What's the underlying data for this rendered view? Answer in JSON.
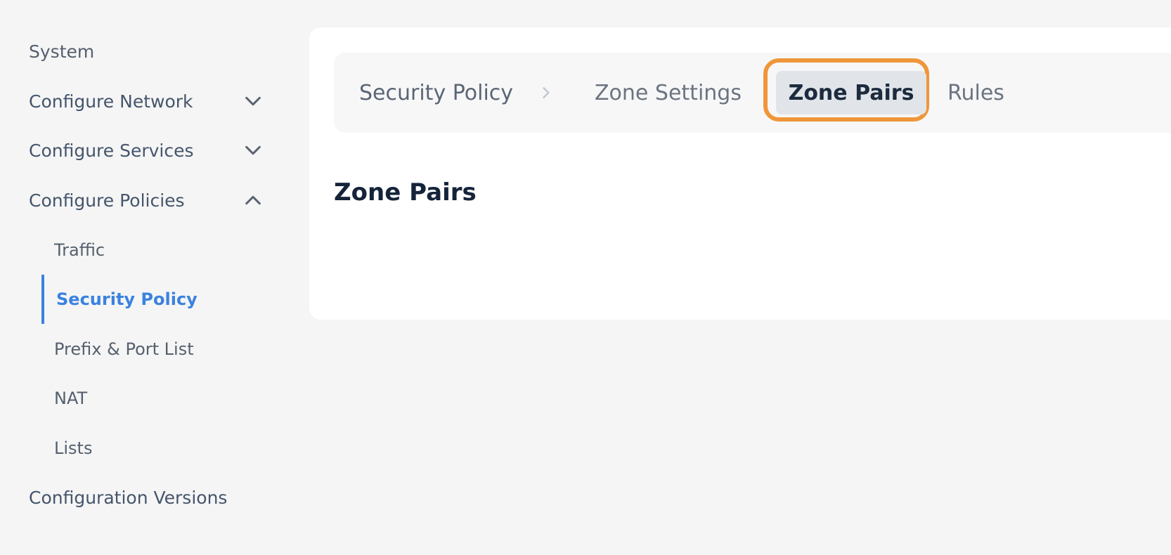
{
  "sidebar": {
    "system": "System",
    "configure_network": "Configure Network",
    "configure_services": "Configure Services",
    "configure_policies": "Configure Policies",
    "policy_items": [
      {
        "label": "Traffic"
      },
      {
        "label": "Security Policy"
      },
      {
        "label": "Prefix & Port List"
      },
      {
        "label": "NAT"
      },
      {
        "label": "Lists"
      }
    ],
    "configuration_versions": "Configuration Versions",
    "active_item": "Security Policy"
  },
  "tabs": {
    "breadcrumb": "Security Policy",
    "zone_settings": "Zone Settings",
    "zone_pairs": "Zone Pairs",
    "rules": "Rules",
    "selected": "Zone Pairs"
  },
  "main": {
    "title": "Zone Pairs"
  },
  "colors": {
    "accent": "#3b82e0",
    "highlight": "#ef963a",
    "active_tab_bg": "#e1e5e9"
  },
  "icons": {
    "chevron_down": "chevron-down-icon",
    "chevron_up": "chevron-up-icon",
    "breadcrumb_separator": "chevron-right-icon"
  }
}
